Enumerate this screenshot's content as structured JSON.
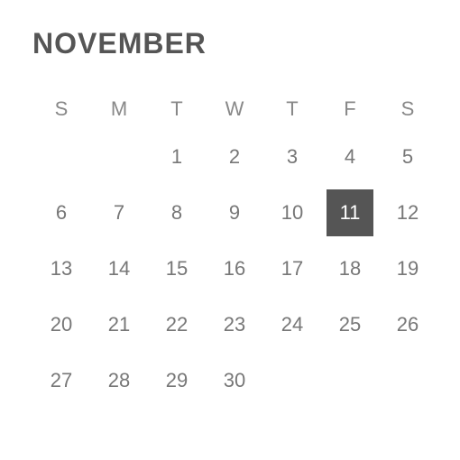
{
  "month_title": "NOVEMBER",
  "weekdays": [
    "S",
    "M",
    "T",
    "W",
    "T",
    "F",
    "S"
  ],
  "weeks": [
    [
      "",
      "",
      "1",
      "2",
      "3",
      "4",
      "5"
    ],
    [
      "6",
      "7",
      "8",
      "9",
      "10",
      "11",
      "12"
    ],
    [
      "13",
      "14",
      "15",
      "16",
      "17",
      "18",
      "19"
    ],
    [
      "20",
      "21",
      "22",
      "23",
      "24",
      "25",
      "26"
    ],
    [
      "27",
      "28",
      "29",
      "30",
      "",
      "",
      ""
    ]
  ],
  "selected_day": "11"
}
